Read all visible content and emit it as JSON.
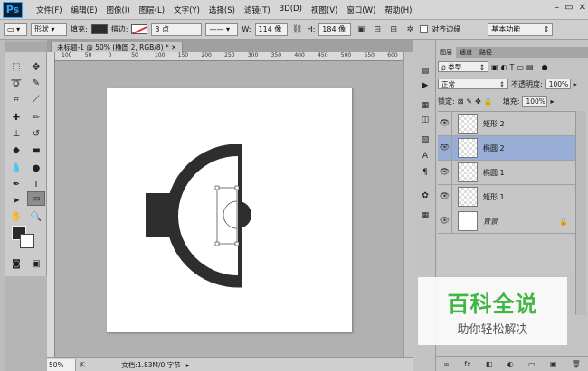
{
  "app": {
    "logo": "Ps"
  },
  "menu": [
    "文件(F)",
    "编辑(E)",
    "图像(I)",
    "图层(L)",
    "文字(Y)",
    "选择(S)",
    "滤镜(T)",
    "3D(D)",
    "视图(V)",
    "窗口(W)",
    "帮助(H)"
  ],
  "window_controls": [
    "–",
    "▭",
    "✕"
  ],
  "options": {
    "shape_mode": "形状",
    "fill_label": "填充:",
    "stroke_label": "描边:",
    "stroke_size": "3 点",
    "w_label": "W:",
    "w_value": "114 像",
    "h_label": "H:",
    "h_value": "184 像",
    "align_edges_label": "对齐边缘",
    "workspace": "基本功能"
  },
  "document": {
    "tab_title": "未标题-1 @ 50% (椭圆 2, RGB/8) *",
    "ruler_ticks": [
      "100",
      "50",
      "0",
      "50",
      "100",
      "150",
      "200",
      "250",
      "300",
      "350",
      "400",
      "450",
      "500",
      "550",
      "600"
    ],
    "zoom": "50%",
    "status": "文档:1.83M/0 字节"
  },
  "panel": {
    "tabs": [
      "图层",
      "通道",
      "路径"
    ],
    "filter_kind": "ρ 类型",
    "blend_mode": "正常",
    "opacity_label": "不透明度:",
    "opacity_value": "100%",
    "lock_label": "锁定:",
    "fill_label": "填充:",
    "fill_value": "100%",
    "layers": [
      {
        "name": "矩形 2",
        "selected": false,
        "italic": false
      },
      {
        "name": "椭圆 2",
        "selected": true,
        "italic": false
      },
      {
        "name": "椭圆 1",
        "selected": false,
        "italic": false
      },
      {
        "name": "矩形 1",
        "selected": false,
        "italic": false
      },
      {
        "name": "背景",
        "selected": false,
        "italic": true
      }
    ],
    "footer_icons": [
      "∞",
      "fx",
      "◧",
      "◐",
      "▭",
      "▣",
      "🗑"
    ]
  },
  "watermark": {
    "title": "百科全说",
    "subtitle": "助你轻松解决"
  },
  "colors": {
    "selected_layer": "#98aed7",
    "shape": "#2e2e2e",
    "watermark_green": "#3fb742"
  }
}
